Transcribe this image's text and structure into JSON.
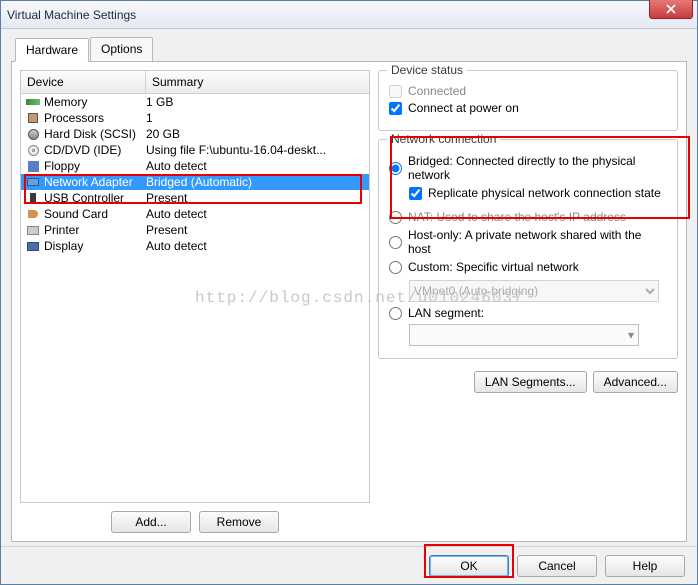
{
  "title": "Virtual Machine Settings",
  "tabs": {
    "hardware": "Hardware",
    "options": "Options"
  },
  "columns": {
    "device": "Device",
    "summary": "Summary"
  },
  "devices": [
    {
      "name": "Memory",
      "summary": "1 GB",
      "selected": false
    },
    {
      "name": "Processors",
      "summary": "1",
      "selected": false
    },
    {
      "name": "Hard Disk (SCSI)",
      "summary": "20 GB",
      "selected": false
    },
    {
      "name": "CD/DVD (IDE)",
      "summary": "Using file F:\\ubuntu-16.04-deskt...",
      "selected": false
    },
    {
      "name": "Floppy",
      "summary": "Auto detect",
      "selected": false
    },
    {
      "name": "Network Adapter",
      "summary": "Bridged (Automatic)",
      "selected": true
    },
    {
      "name": "USB Controller",
      "summary": "Present",
      "selected": false
    },
    {
      "name": "Sound Card",
      "summary": "Auto detect",
      "selected": false
    },
    {
      "name": "Printer",
      "summary": "Present",
      "selected": false
    },
    {
      "name": "Display",
      "summary": "Auto detect",
      "selected": false
    }
  ],
  "status": {
    "title": "Device status",
    "connected": "Connected",
    "power_on": "Connect at power on"
  },
  "netconn": {
    "title": "Network connection",
    "bridged": "Bridged: Connected directly to the physical network",
    "replicate": "Replicate physical network connection state",
    "nat": "NAT: Used to share the host's IP address",
    "host_only": "Host-only: A private network shared with the host",
    "custom": "Custom: Specific virtual network",
    "vmnet": "VMnet0 (Auto-bridging)",
    "lan_segment": "LAN segment:"
  },
  "buttons": {
    "lan_segments": "LAN Segments...",
    "advanced": "Advanced...",
    "add": "Add...",
    "remove": "Remove",
    "ok": "OK",
    "cancel": "Cancel",
    "help": "Help"
  },
  "watermark": "http://blog.csdn.net/u010246037"
}
